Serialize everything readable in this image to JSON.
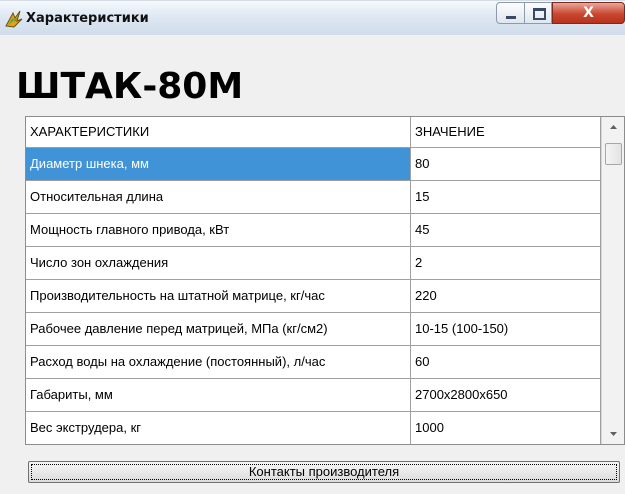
{
  "window": {
    "title": "Характеристики",
    "close_label": "X"
  },
  "model": {
    "name": "ШТАК-80М"
  },
  "table": {
    "columns": [
      "ХАРАКТЕРИСТИКИ",
      "ЗНАЧЕНИЕ"
    ],
    "rows": [
      {
        "name": "Диаметр шнека, мм",
        "value": "80"
      },
      {
        "name": "Относительная длина",
        "value": "15"
      },
      {
        "name": "Мощность главного привода, кВт",
        "value": "45"
      },
      {
        "name": "Число зон охлаждения",
        "value": "2"
      },
      {
        "name": "Производительность на штатной матрице, кг/час",
        "value": "220"
      },
      {
        "name": "Рабочее давление перед матрицей, МПа (кг/см2)",
        "value": "10-15 (100-150)"
      },
      {
        "name": "Расход воды на охлаждение (постоянный), л/час",
        "value": "60"
      },
      {
        "name": "Габариты, мм",
        "value": "2700x2800x650"
      },
      {
        "name": "Вес экструдера, кг",
        "value": "1000"
      }
    ],
    "selected_row": 0
  },
  "buttons": {
    "contacts": "Контакты производителя"
  },
  "colors": {
    "selection": "#3f93d6",
    "close_button": "#c8472f"
  },
  "icons": {
    "title": "app-icon",
    "minimize": "minimize-icon",
    "maximize": "maximize-icon",
    "close": "close-icon",
    "scroll_up": "chevron-up-icon",
    "scroll_down": "chevron-down-icon"
  }
}
